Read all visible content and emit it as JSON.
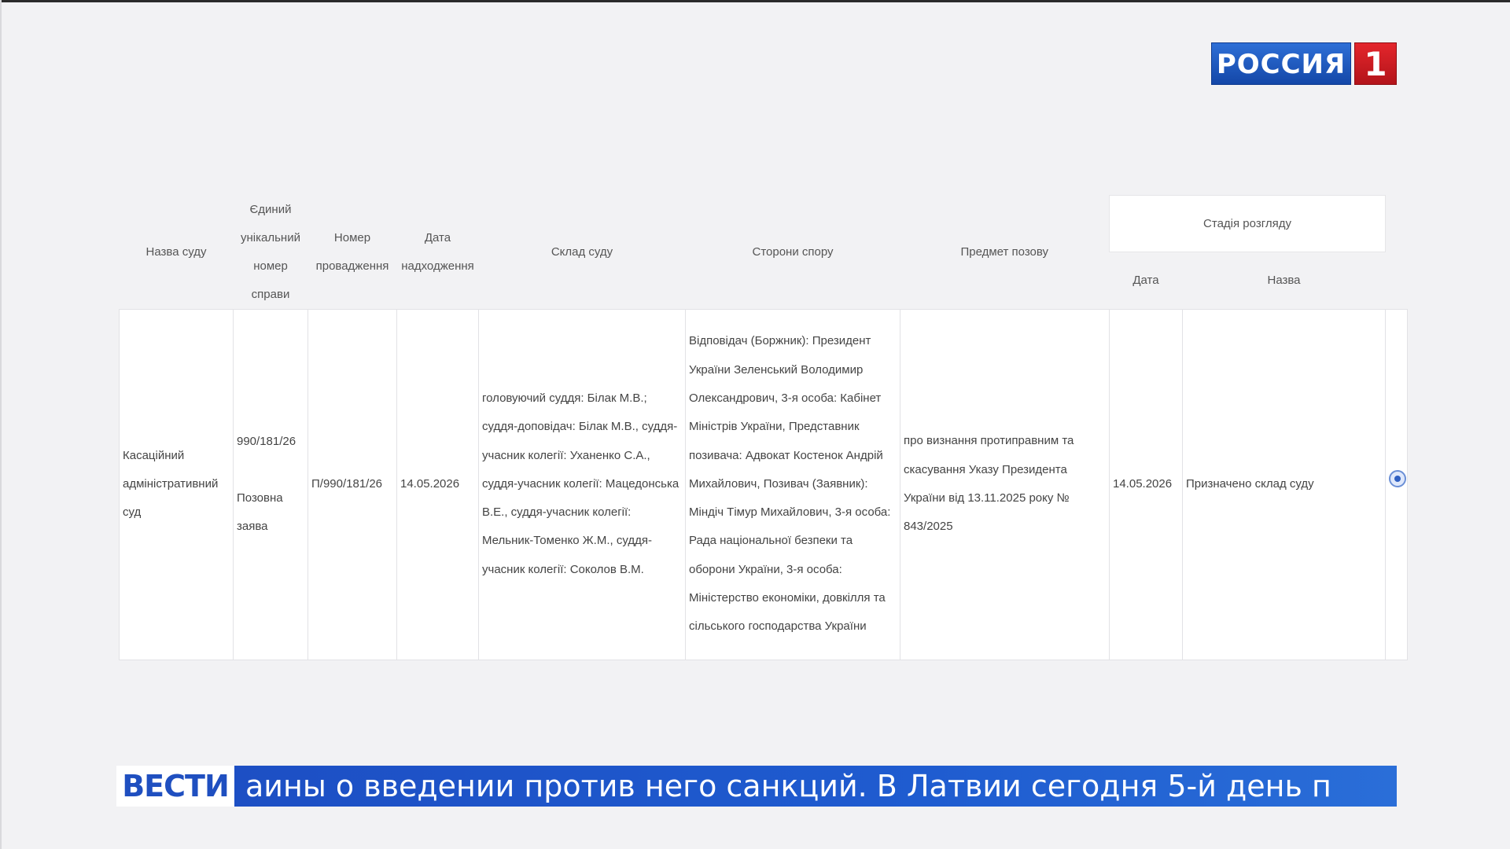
{
  "channel": {
    "name": "РОССИЯ",
    "number": "1"
  },
  "table": {
    "headers": {
      "court_name": "Назва суду",
      "unique_number": "Єдиний унікальний номер справи",
      "proceeding_number": "Номер провадження",
      "receipt_date": "Дата надходження",
      "court_composition": "Склад суду",
      "parties": "Сторони спору",
      "subject": "Предмет позову",
      "stage": "Стадія розгляду",
      "stage_date": "Дата",
      "stage_name": "Назва"
    },
    "rows": [
      {
        "court_name": "Касаційний адміністративний суд",
        "unique_number": "990/181/26",
        "case_type": "Позовна заява",
        "proceeding_number": "П/990/181/26",
        "receipt_date": "14.05.2026",
        "court_composition": "головуючий суддя: Білак М.В.; суддя-доповідач: Білак М.В., суддя-учасник колегії: Уханенко С.А., суддя-учасник колегії: Мацедонська В.Е., суддя-учасник колегії: Мельник-Томенко Ж.М., суддя-учасник колегії: Соколов В.М.",
        "parties": "Відповідач (Боржник): Президент України Зеленський Володимир Олександрович, 3-я особа: Кабінет Міністрів України, Представник позивача: Адвокат Костенок Андрій Михайлович, Позивач (Заявник): Міндіч Тімур Михайлович, 3-я особа: Рада національної безпеки та оборони України, 3-я особа: Міністерство економіки, довкілля та сільського господарства України",
        "subject": "про визнання протиправним та скасування Указу Президента України від 13.11.2025 року № 843/2025",
        "stage_date": "14.05.2026",
        "stage_name": "Призначено склад суду"
      }
    ]
  },
  "ticker": {
    "brand": "ВЕСТИ",
    "text": "аины о введении против него санкций. В Латвии сегодня 5-й день п"
  }
}
